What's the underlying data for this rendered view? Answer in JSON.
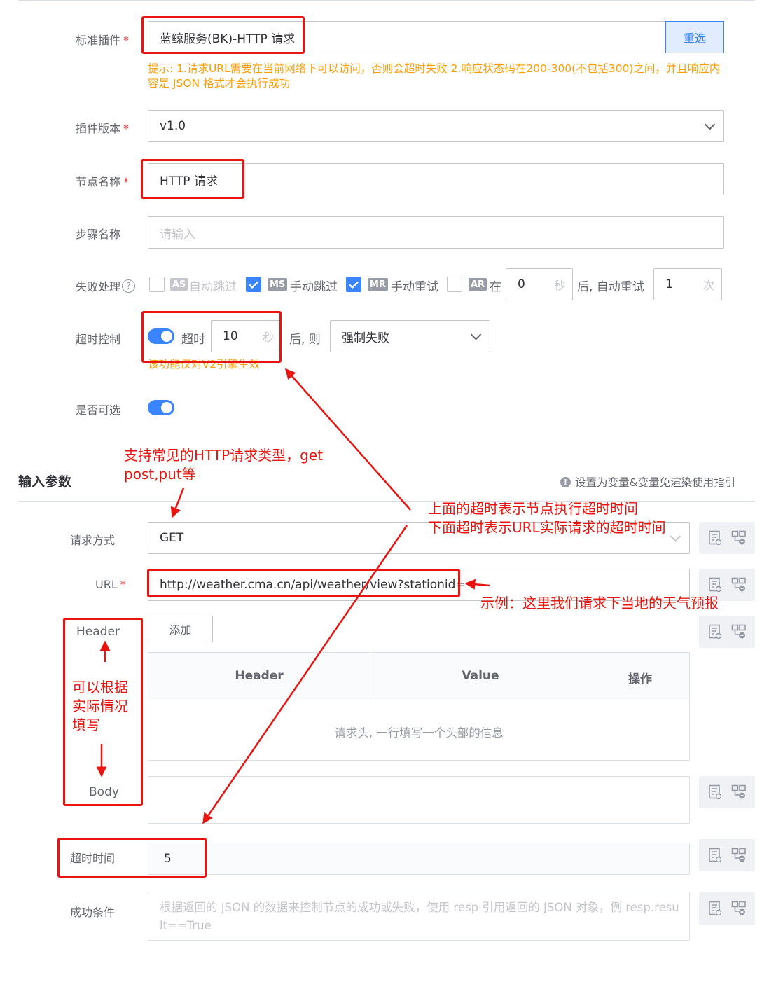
{
  "form": {
    "plugin": {
      "label": "标准插件",
      "value": "蓝鲸服务(BK)-HTTP 请求",
      "reselect": "重选",
      "hint": "提示: 1.请求URL需要在当前网络下可以访问，否则会超时失败 2.响应状态码在200-300(不包括300)之间，并且响应内容是 JSON 格式才会执行成功"
    },
    "version": {
      "label": "插件版本",
      "value": "v1.0"
    },
    "node_name": {
      "label": "节点名称",
      "value": "HTTP 请求"
    },
    "step_name": {
      "label": "步骤名称",
      "placeholder": "请输入"
    },
    "failure": {
      "label": "失败处理",
      "auto_skip": {
        "tag": "AS",
        "label": "自动跳过",
        "checked": false
      },
      "manual_skip": {
        "tag": "MS",
        "label": "手动跳过",
        "checked": true
      },
      "manual_retry": {
        "tag": "MR",
        "label": "手动重试",
        "checked": true
      },
      "auto_retry": {
        "tag": "AR",
        "in": "在",
        "seconds": "0",
        "sec_unit": "秒",
        "after": "后, 自动重试",
        "times": "1",
        "times_unit": "次"
      }
    },
    "timeout": {
      "label": "超时控制",
      "prefix": "超时",
      "value": "10",
      "unit": "秒",
      "after": "后, 则",
      "action": "强制失败",
      "hint": "该功能仅对V2引擎生效"
    },
    "optional": {
      "label": "是否可选"
    }
  },
  "input_params": {
    "title": "输入参数",
    "guide": "设置为变量&变量免渲染使用指引",
    "method": {
      "label": "请求方式",
      "value": "GET"
    },
    "url": {
      "label": "URL",
      "value": "http://weather.cma.cn/api/weather/view?stationid="
    },
    "header": {
      "label": "Header",
      "add_button": "添加",
      "columns": [
        "Header",
        "Value",
        "操作"
      ],
      "empty": "请求头, 一行填写一个头部的信息"
    },
    "body": {
      "label": "Body"
    },
    "timeout": {
      "label": "超时时间",
      "value": "5"
    },
    "success": {
      "label": "成功条件",
      "placeholder": "根据返回的 JSON 的数据来控制节点的成功或失败，使用 resp 引用返回的 JSON 对象，例 resp.result==True"
    }
  },
  "annotations": {
    "http_types": [
      "支持常见的HTTP请求类型，get",
      "post,put等"
    ],
    "timeouts": [
      "上面的超时表示节点执行超时时间",
      "下面超时表示URL实际请求的超时时间"
    ],
    "example": "示例：这里我们请求下当地的天气预报",
    "fill": [
      "可以根据",
      "实际情况",
      "填写"
    ]
  },
  "colors": {
    "primary": "#3a84ff",
    "warning": "#ff9c01",
    "annotation": "#e8140f"
  }
}
